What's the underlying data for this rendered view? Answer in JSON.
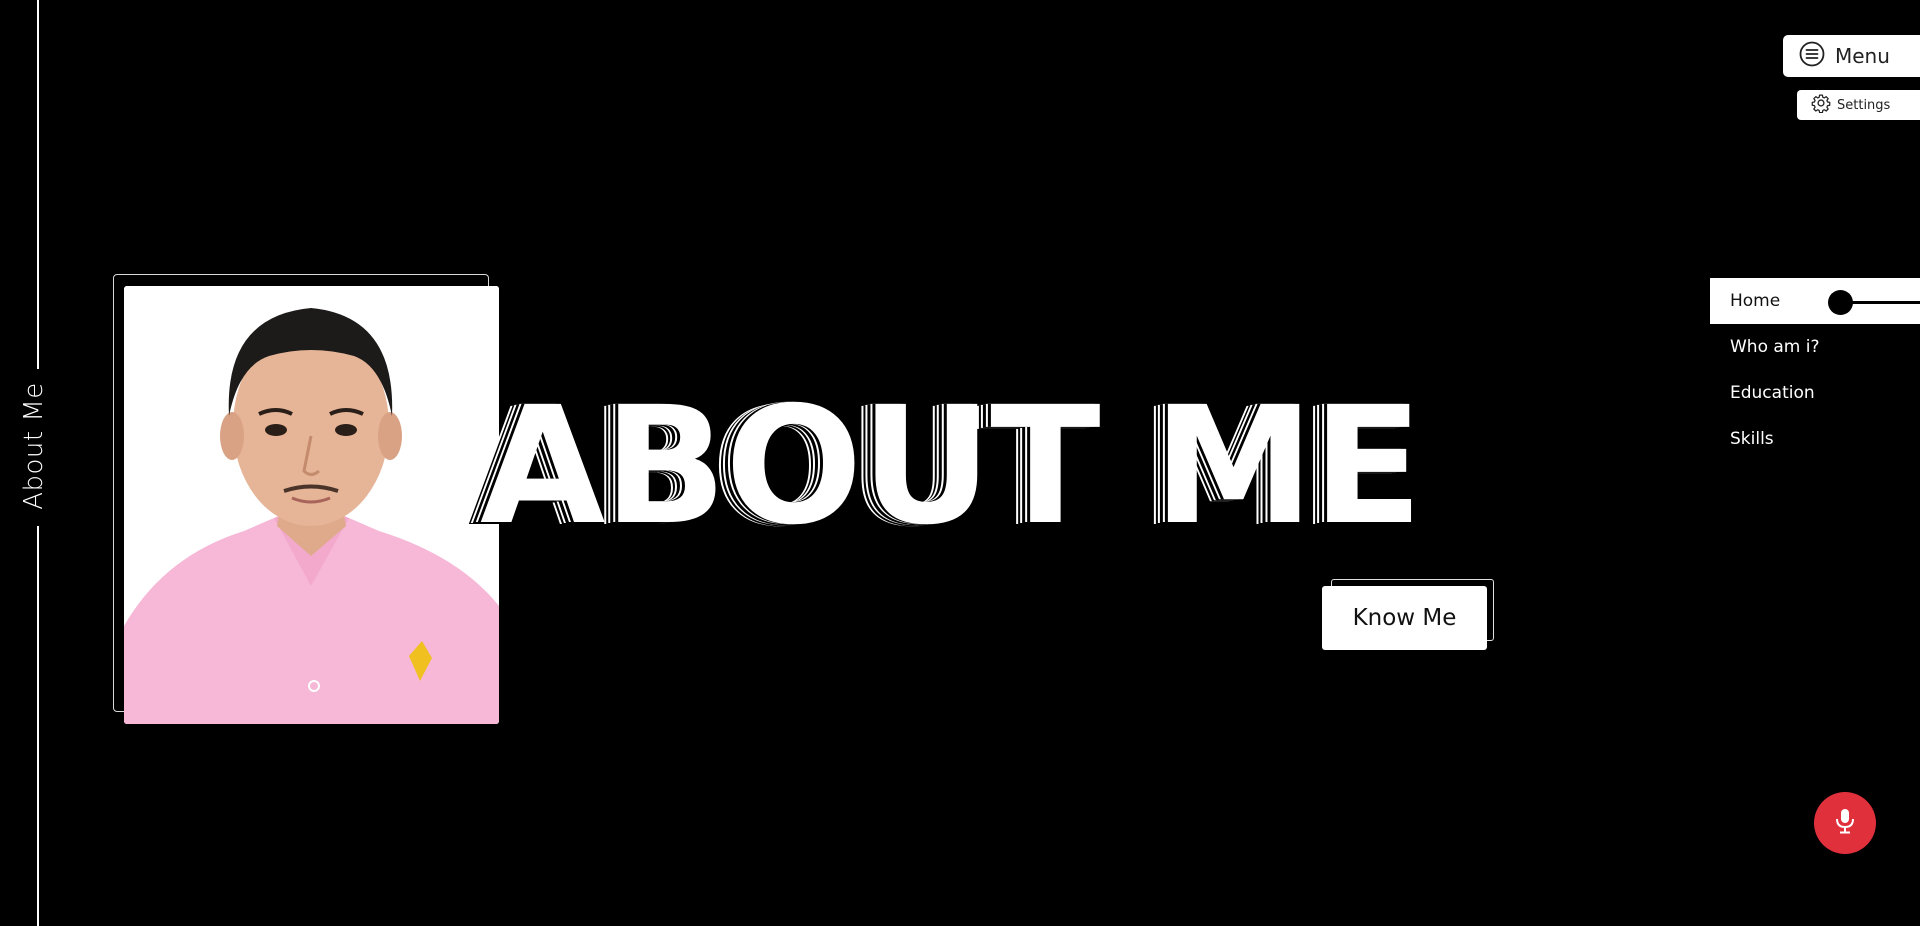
{
  "sidebar": {
    "label": "About Me"
  },
  "hero": {
    "title": "ABOUT ME",
    "cta_label": "Know Me"
  },
  "toolbar": {
    "menu_label": "Menu",
    "settings_label": "Settings"
  },
  "nav": {
    "items": [
      {
        "label": "Home",
        "active": true
      },
      {
        "label": "Who am i?",
        "active": false
      },
      {
        "label": "Education",
        "active": false
      },
      {
        "label": "Skills",
        "active": false
      }
    ]
  },
  "icons": {
    "menu": "menu-circle-icon",
    "settings": "gear-icon",
    "mic": "microphone-icon"
  },
  "colors": {
    "background": "#000000",
    "foreground": "#ffffff",
    "mic_button": "#e0303c"
  }
}
